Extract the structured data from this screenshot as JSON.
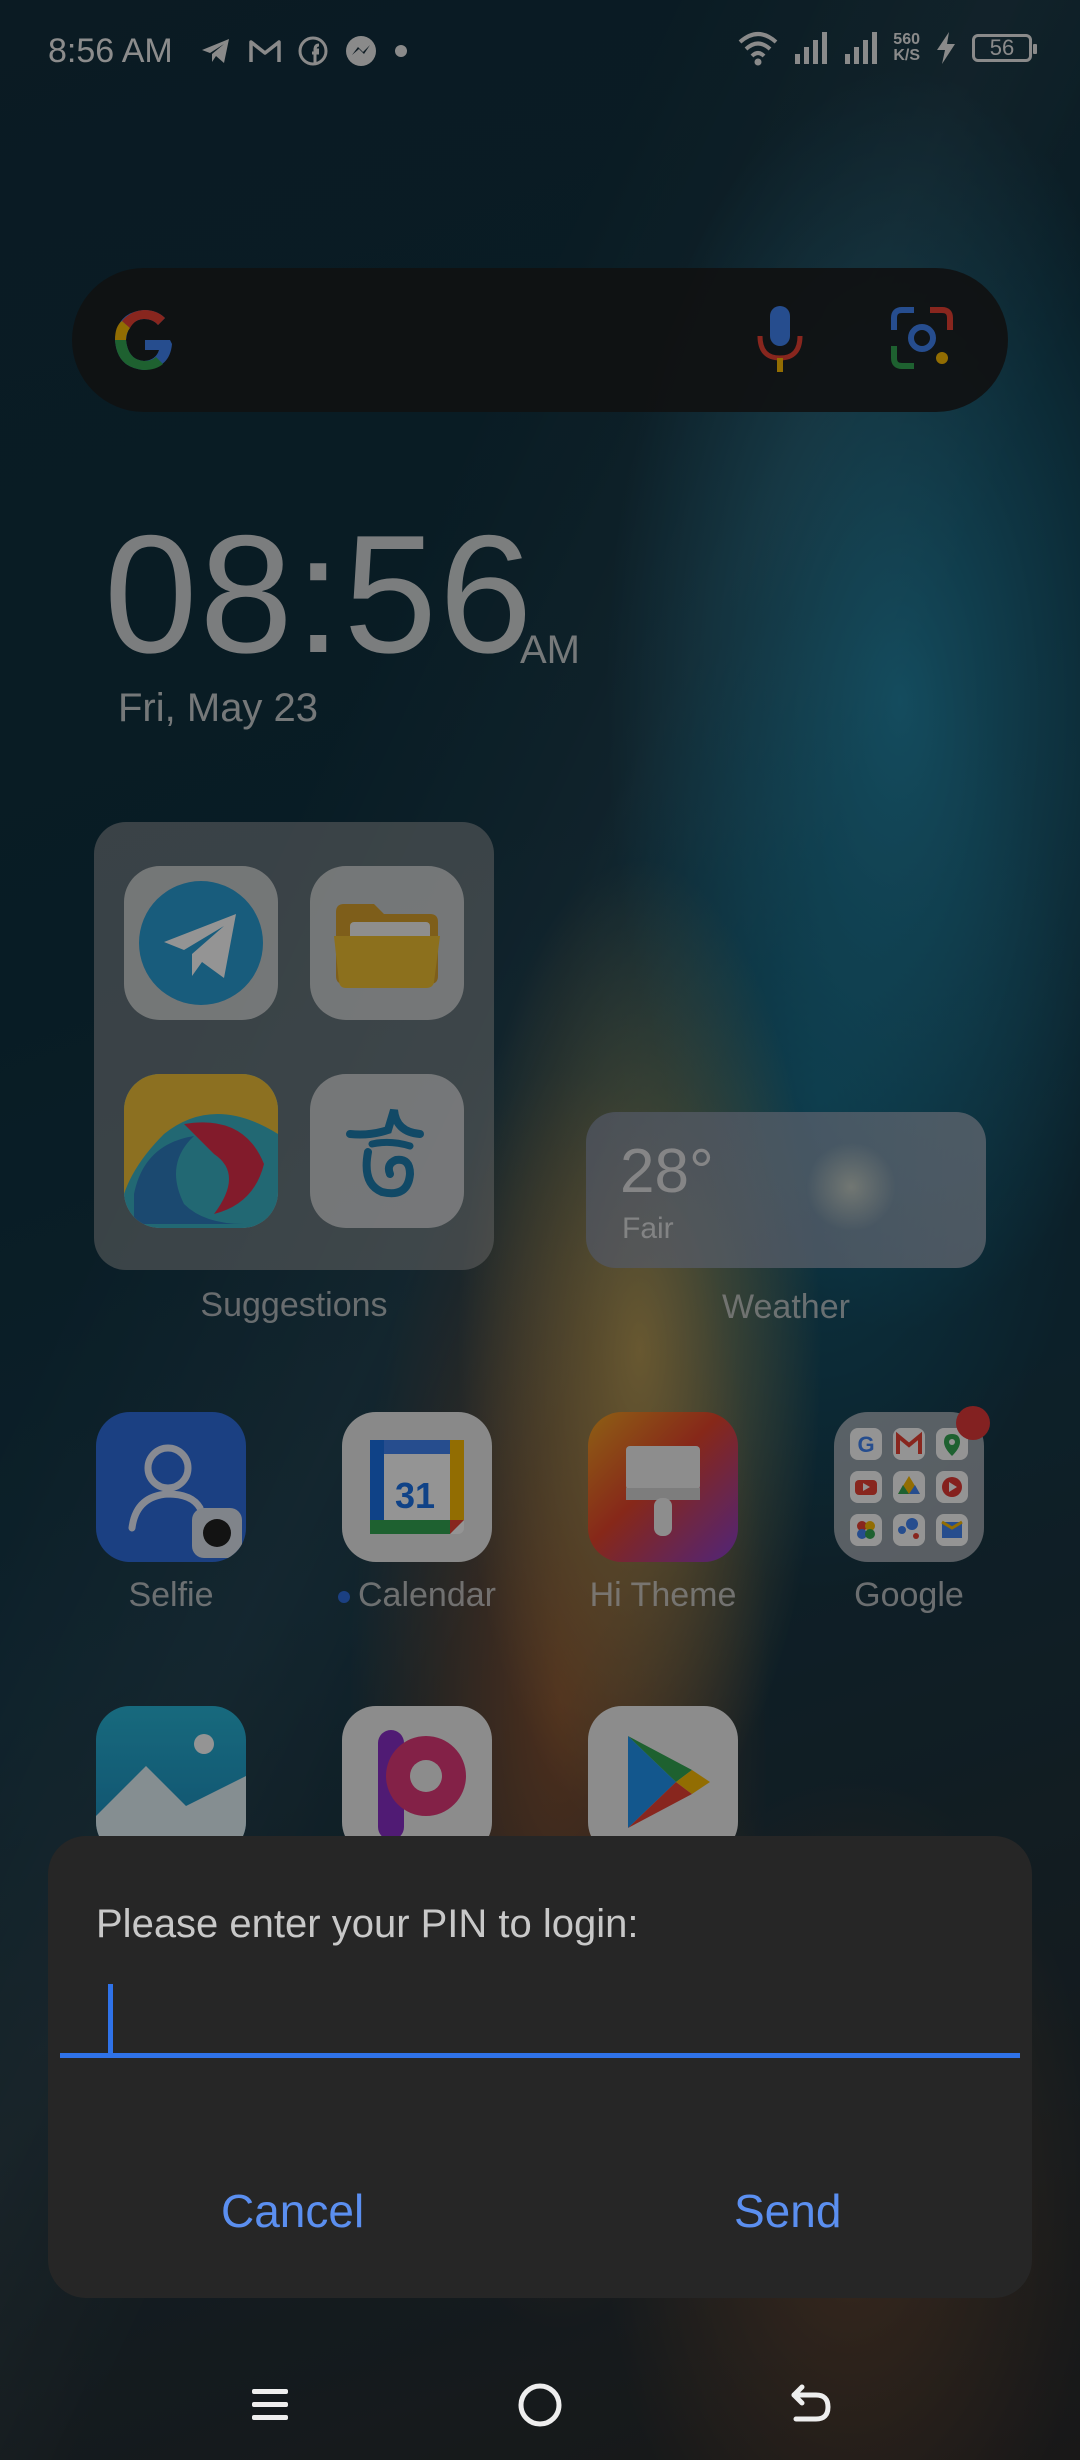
{
  "status_bar": {
    "time": "8:56 AM",
    "speed_value": "560",
    "speed_unit": "K/S",
    "battery": "56",
    "left_icons": [
      "telegram-icon",
      "gmail-icon",
      "facebook-icon",
      "messenger-icon",
      "dot-icon"
    ],
    "right_icons": [
      "wifi-icon",
      "signal-icon",
      "signal-icon",
      "charging-icon",
      "battery-icon"
    ]
  },
  "search_bar": {
    "icons": [
      "google-g-icon",
      "mic-icon",
      "lens-icon"
    ]
  },
  "clock": {
    "time": "08:56",
    "ampm": "AM",
    "date": "Fri, May 23"
  },
  "widgets": {
    "suggestions_label": "Suggestions",
    "weather_label": "Weather",
    "weather_temp": "28°",
    "weather_condition": "Fair"
  },
  "apps": [
    {
      "label": "Selfie"
    },
    {
      "label": "Calendar",
      "calendar_day": "31"
    },
    {
      "label": "Hi Theme"
    },
    {
      "label": "Google"
    }
  ],
  "dialog": {
    "prompt": "Please enter your PIN to login:",
    "input_value": "",
    "cancel_label": "Cancel",
    "send_label": "Send"
  },
  "nav": {
    "icons": [
      "menu-icon",
      "home-icon",
      "back-icon"
    ]
  },
  "colors": {
    "accent": "#2f72e8",
    "button_text": "#5b8ff0",
    "dialog_bg": "#262626"
  }
}
